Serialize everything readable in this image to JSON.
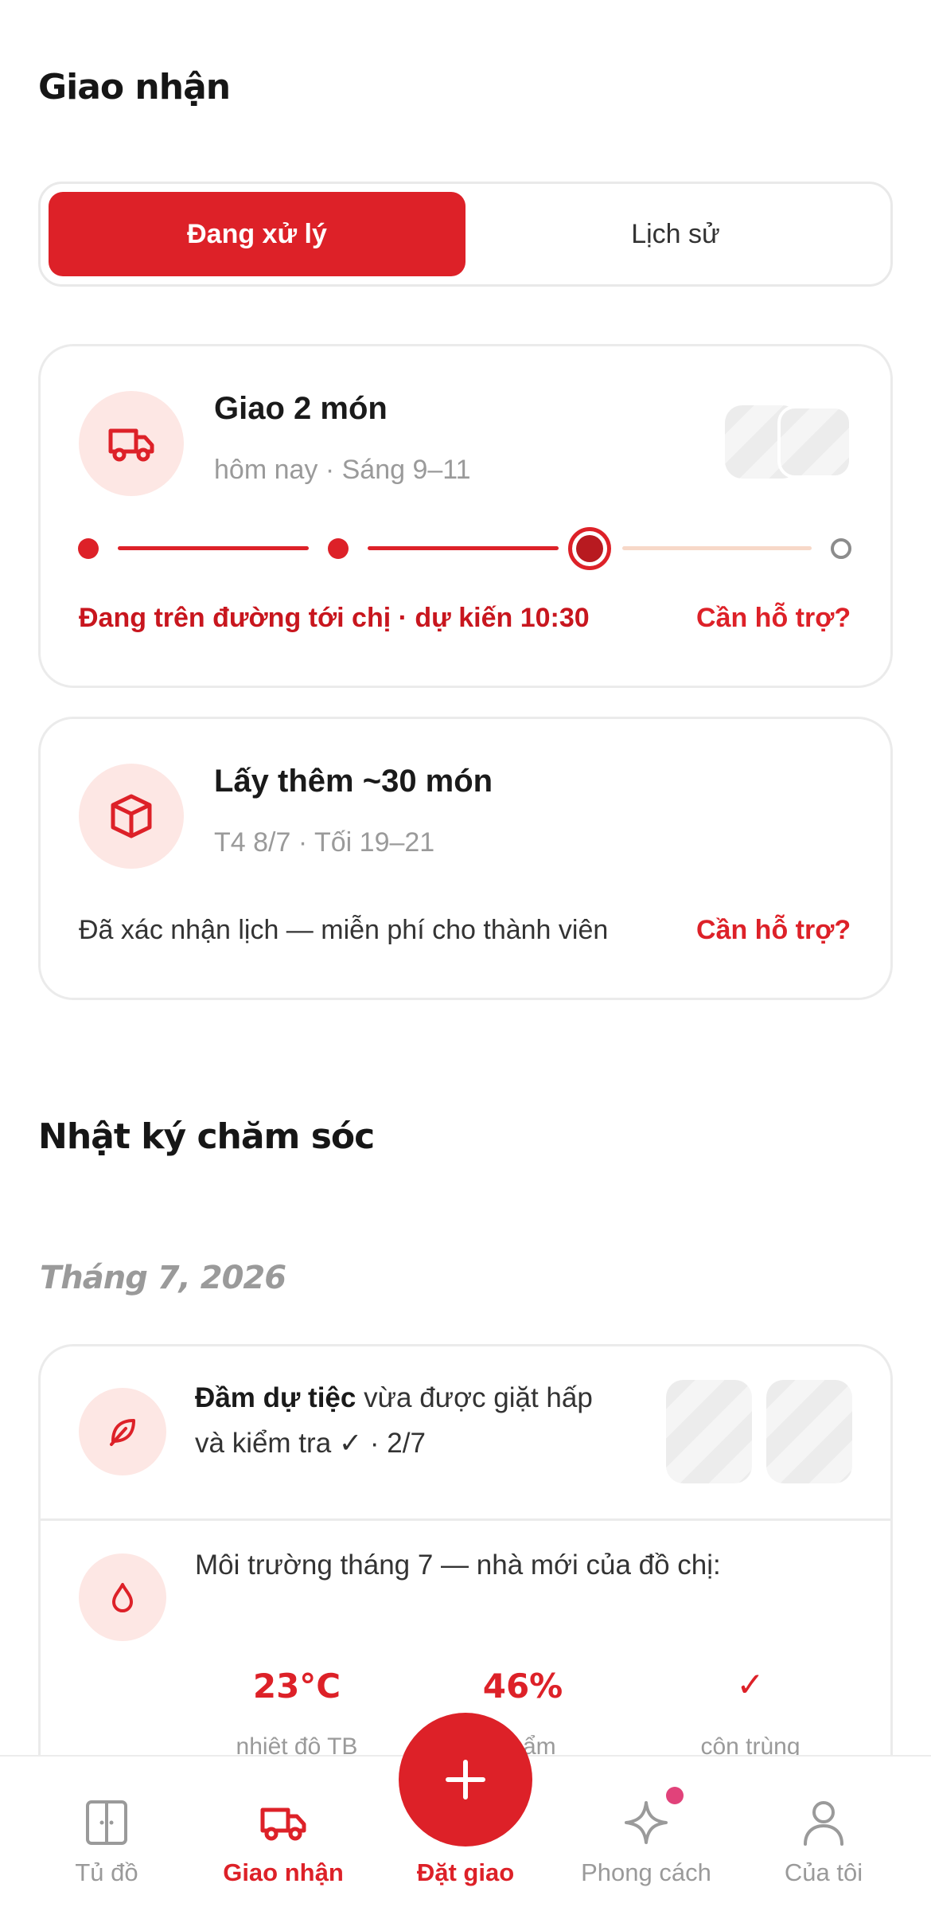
{
  "header": {
    "title": "Giao nhận"
  },
  "segment": {
    "active_label": "Đang xử lý",
    "inactive_label": "Lịch sử"
  },
  "delivery_card": {
    "title": "Giao 2 món",
    "subtitle": "hôm nay · Sáng 9–11",
    "status": "Đang trên đường tới chị · dự kiến 10:30",
    "help": "Cần hỗ trợ?",
    "progress_step": 3,
    "progress_total": 4,
    "icon": "truck-icon"
  },
  "pickup_card": {
    "title": "Lấy thêm ~30 món",
    "subtitle": "T4 8/7 · Tối 19–21",
    "note": "Đã xác nhận lịch — miễn phí cho thành viên",
    "help": "Cần hỗ trợ?",
    "icon": "box-icon"
  },
  "care_log": {
    "title": "Nhật ký chăm sóc",
    "month": "Tháng 7, 2026",
    "entry1": {
      "bold": "Đầm dự tiệc",
      "rest1": " vừa được giặt hấp",
      "line2": "và kiểm tra ✓ · 2/7",
      "icon": "leaf-icon"
    },
    "entry2": {
      "text": "Môi trường tháng 7 — nhà mới của đồ chị:",
      "icon": "droplet-icon",
      "stats": [
        {
          "value": "23°C",
          "label": "nhiệt độ TB"
        },
        {
          "value": "46%",
          "label": "độ ẩm"
        },
        {
          "value": "✓",
          "label": "côn trùng"
        }
      ]
    }
  },
  "nav": {
    "items": [
      {
        "label": "Tủ đồ",
        "icon": "wardrobe-icon"
      },
      {
        "label": "Giao nhận",
        "icon": "truck-icon"
      },
      {
        "label": "Đặt giao",
        "icon": "plus-icon"
      },
      {
        "label": "Phong cách",
        "icon": "sparkle-icon"
      },
      {
        "label": "Của tôi",
        "icon": "user-icon"
      }
    ],
    "active_index": 1
  },
  "colors": {
    "accent": "#dd2128",
    "accent_light": "#fde7e4",
    "muted": "#9a9a9a"
  }
}
